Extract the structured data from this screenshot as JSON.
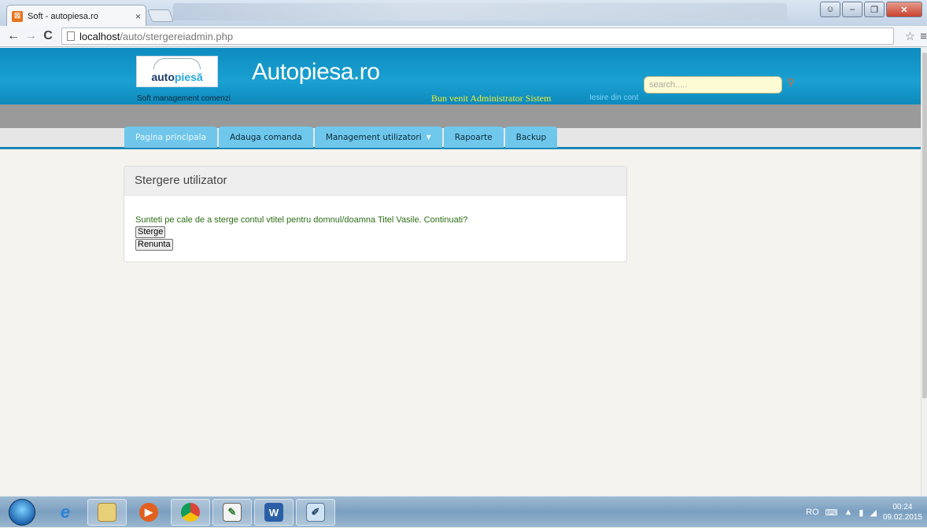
{
  "browser": {
    "tab_title": "Soft - autopiesa.ro",
    "tab_close": "×",
    "url_host": "localhost",
    "url_path": "/auto/stergereiadmin.php"
  },
  "site": {
    "logo_text_a": "auto",
    "logo_text_b": "piesă",
    "subtitle": "Soft management comenzi",
    "brand": "Autopiesa.ro",
    "welcome": "Bun venit Administrator Sistem",
    "logout": "Iesire din cont",
    "search_placeholder": "search....."
  },
  "menu": {
    "items": [
      {
        "label": "Pagina principala"
      },
      {
        "label": "Adauga comanda"
      },
      {
        "label": "Management utilizatori"
      },
      {
        "label": "Rapoarte"
      },
      {
        "label": "Backup"
      }
    ]
  },
  "panel": {
    "title": "Stergere utilizator",
    "message": "Sunteti pe cale de a sterge contul vtitel pentru domnul/doamna Titel Vasile. Continuati?",
    "delete_button": "Sterge",
    "cancel_button": "Renunta"
  },
  "taskbar": {
    "language": "RO",
    "time": "00:24",
    "date": "09.02.2015"
  },
  "colors": {
    "header": "#1aa0d2",
    "menu_tab": "#6fc8ec",
    "welcome_text": "#f3ef2a",
    "message_text": "#2c6e16"
  }
}
